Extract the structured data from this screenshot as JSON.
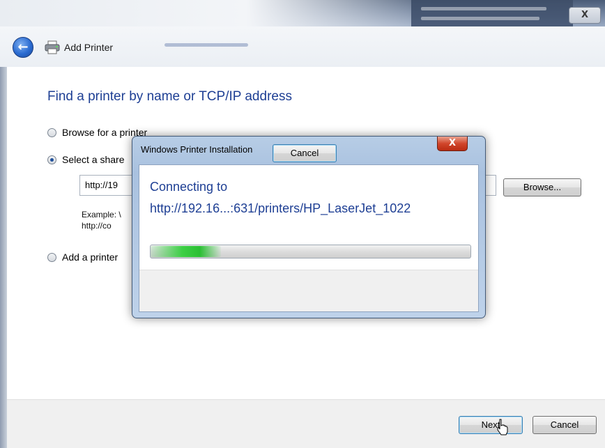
{
  "window": {
    "title": "Add Printer",
    "close_glyph": "X"
  },
  "main": {
    "heading": "Find a printer by name or TCP/IP address",
    "options": [
      {
        "label": "Browse for a printer",
        "checked": false
      },
      {
        "label": "Select a share",
        "checked": true
      },
      {
        "label": "Add a printer",
        "checked": false
      }
    ],
    "url_value": "http://19",
    "example_text": "Example: \\\nhttp://co",
    "browse_label": "Browse..."
  },
  "footer": {
    "next_label": "Next",
    "cancel_label": "Cancel"
  },
  "dialog": {
    "title": "Windows Printer Installation",
    "close_glyph": "X",
    "line1": "Connecting to",
    "line2": "http://192.16...:631/printers/HP_LaserJet_1022",
    "progress": 0.22,
    "cancel_label": "Cancel",
    "progress_color": "#3dcf46"
  },
  "icons": {
    "back": "back-arrow-icon",
    "printer": "printer-icon",
    "cursor": "mouse-cursor-icon"
  }
}
